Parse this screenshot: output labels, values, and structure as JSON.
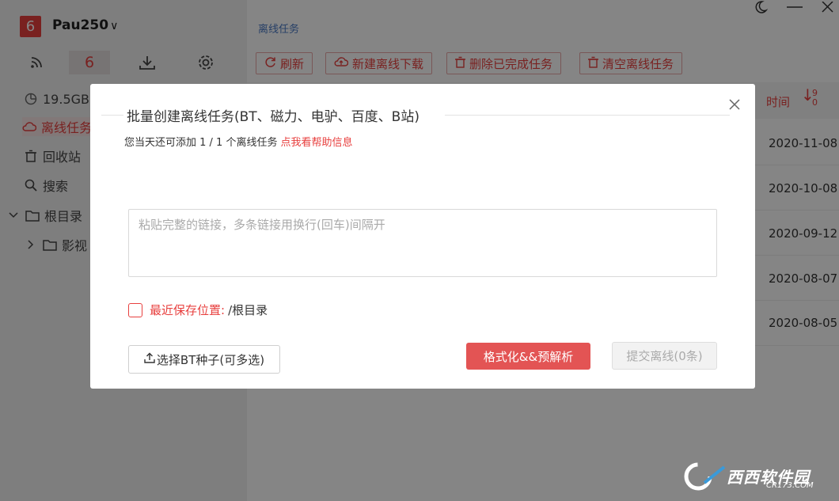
{
  "app": {
    "logo_text": "6",
    "username": "Pau250",
    "chevron": "∨"
  },
  "sidebar": {
    "toolbar": [
      {
        "name": "rss-icon",
        "label": ""
      },
      {
        "name": "offline-count",
        "label": "6"
      },
      {
        "name": "download-icon",
        "label": ""
      },
      {
        "name": "gear-icon",
        "label": ""
      }
    ],
    "items": [
      {
        "label": "19.5GB",
        "icon": "storage-pie-icon"
      },
      {
        "label": "离线任务",
        "icon": "cloud-icon"
      },
      {
        "label": "回收站",
        "icon": "trash-icon"
      },
      {
        "label": "搜索",
        "icon": "search-icon"
      },
      {
        "label": "根目录",
        "icon": "folder-icon"
      },
      {
        "label": "影视",
        "icon": "folder-icon"
      }
    ]
  },
  "main": {
    "breadcrumb": "离线任务",
    "toolbar": {
      "refresh": "刷新",
      "new_offline": "新建离线下载",
      "delete_done": "删除已完成任务",
      "clear_all": "清空离线任务"
    },
    "table": {
      "time_header": "时间",
      "sort_top": "9",
      "sort_bottom": "0",
      "dates": [
        "2020-11-08",
        "2020-10-08",
        "2020-09-12",
        "2020-08-07",
        "2020-08-05"
      ]
    }
  },
  "modal": {
    "title": "批量创建离线任务(BT、磁力、电驴、百度、B站)",
    "quota_text": "您当天还可添加 1 / 1 个离线任务",
    "help_link": "点我看帮助信息",
    "input_placeholder": "粘贴完整的链接，多条链接用换行(回车)间隔开",
    "save_label": "最近保存位置:",
    "save_path": "/根目录",
    "bt_button": "选择BT种子(可多选)",
    "parse_button": "格式化&&预解析",
    "submit_button": "提交离线(0条)",
    "close": "X"
  },
  "watermark": {
    "text": "西西软件园",
    "sub": "CR173.COM"
  }
}
